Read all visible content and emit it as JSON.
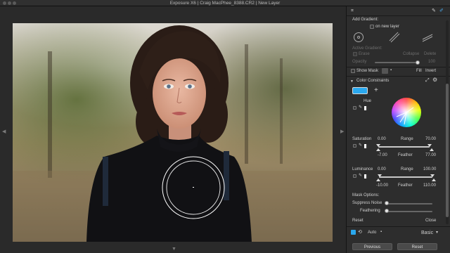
{
  "window": {
    "title": "Exposure X6 | Craig MacPhee_8388.CR2 | New Layer"
  },
  "mask_panel": {
    "add_gradient": "Add Gradient:",
    "on_new_layer": "on new layer",
    "active_gradient": "Active Gradient:",
    "erase": "Erase",
    "collapse": "Collapse",
    "delete": "Delete",
    "opacity_label": "Opacity",
    "opacity_value": "100",
    "opacity_fraction": 1.0,
    "show_mask": "Show Mask",
    "fill": "Fill",
    "invert": "Invert"
  },
  "color_constraints": {
    "title": "Color Constraints",
    "swatch_color": "#2aa8ee",
    "hue_label": "Hue",
    "saturation": {
      "label": "Saturation",
      "min": "0.00",
      "range": "Range",
      "max": "70.00",
      "feather_low": "-7.00",
      "feather": "Feather",
      "feather_high": "77.00"
    },
    "luminance": {
      "label": "Luminance",
      "min": "0.00",
      "range": "Range",
      "max": "100.00",
      "feather_low": "-10.00",
      "feather": "Feather",
      "feather_high": "110.00"
    },
    "mask_options": "Mask Options:",
    "suppress_noise": "Suppress Noise",
    "feathering": "Feathering",
    "reset": "Reset",
    "close": "Close"
  },
  "bottom_bar": {
    "auto": "Auto",
    "preset": "Basic",
    "previous": "Previous",
    "reset": "Reset"
  },
  "colors": {
    "accent": "#2aa8ee",
    "panel_bg": "#2d2d2d"
  }
}
